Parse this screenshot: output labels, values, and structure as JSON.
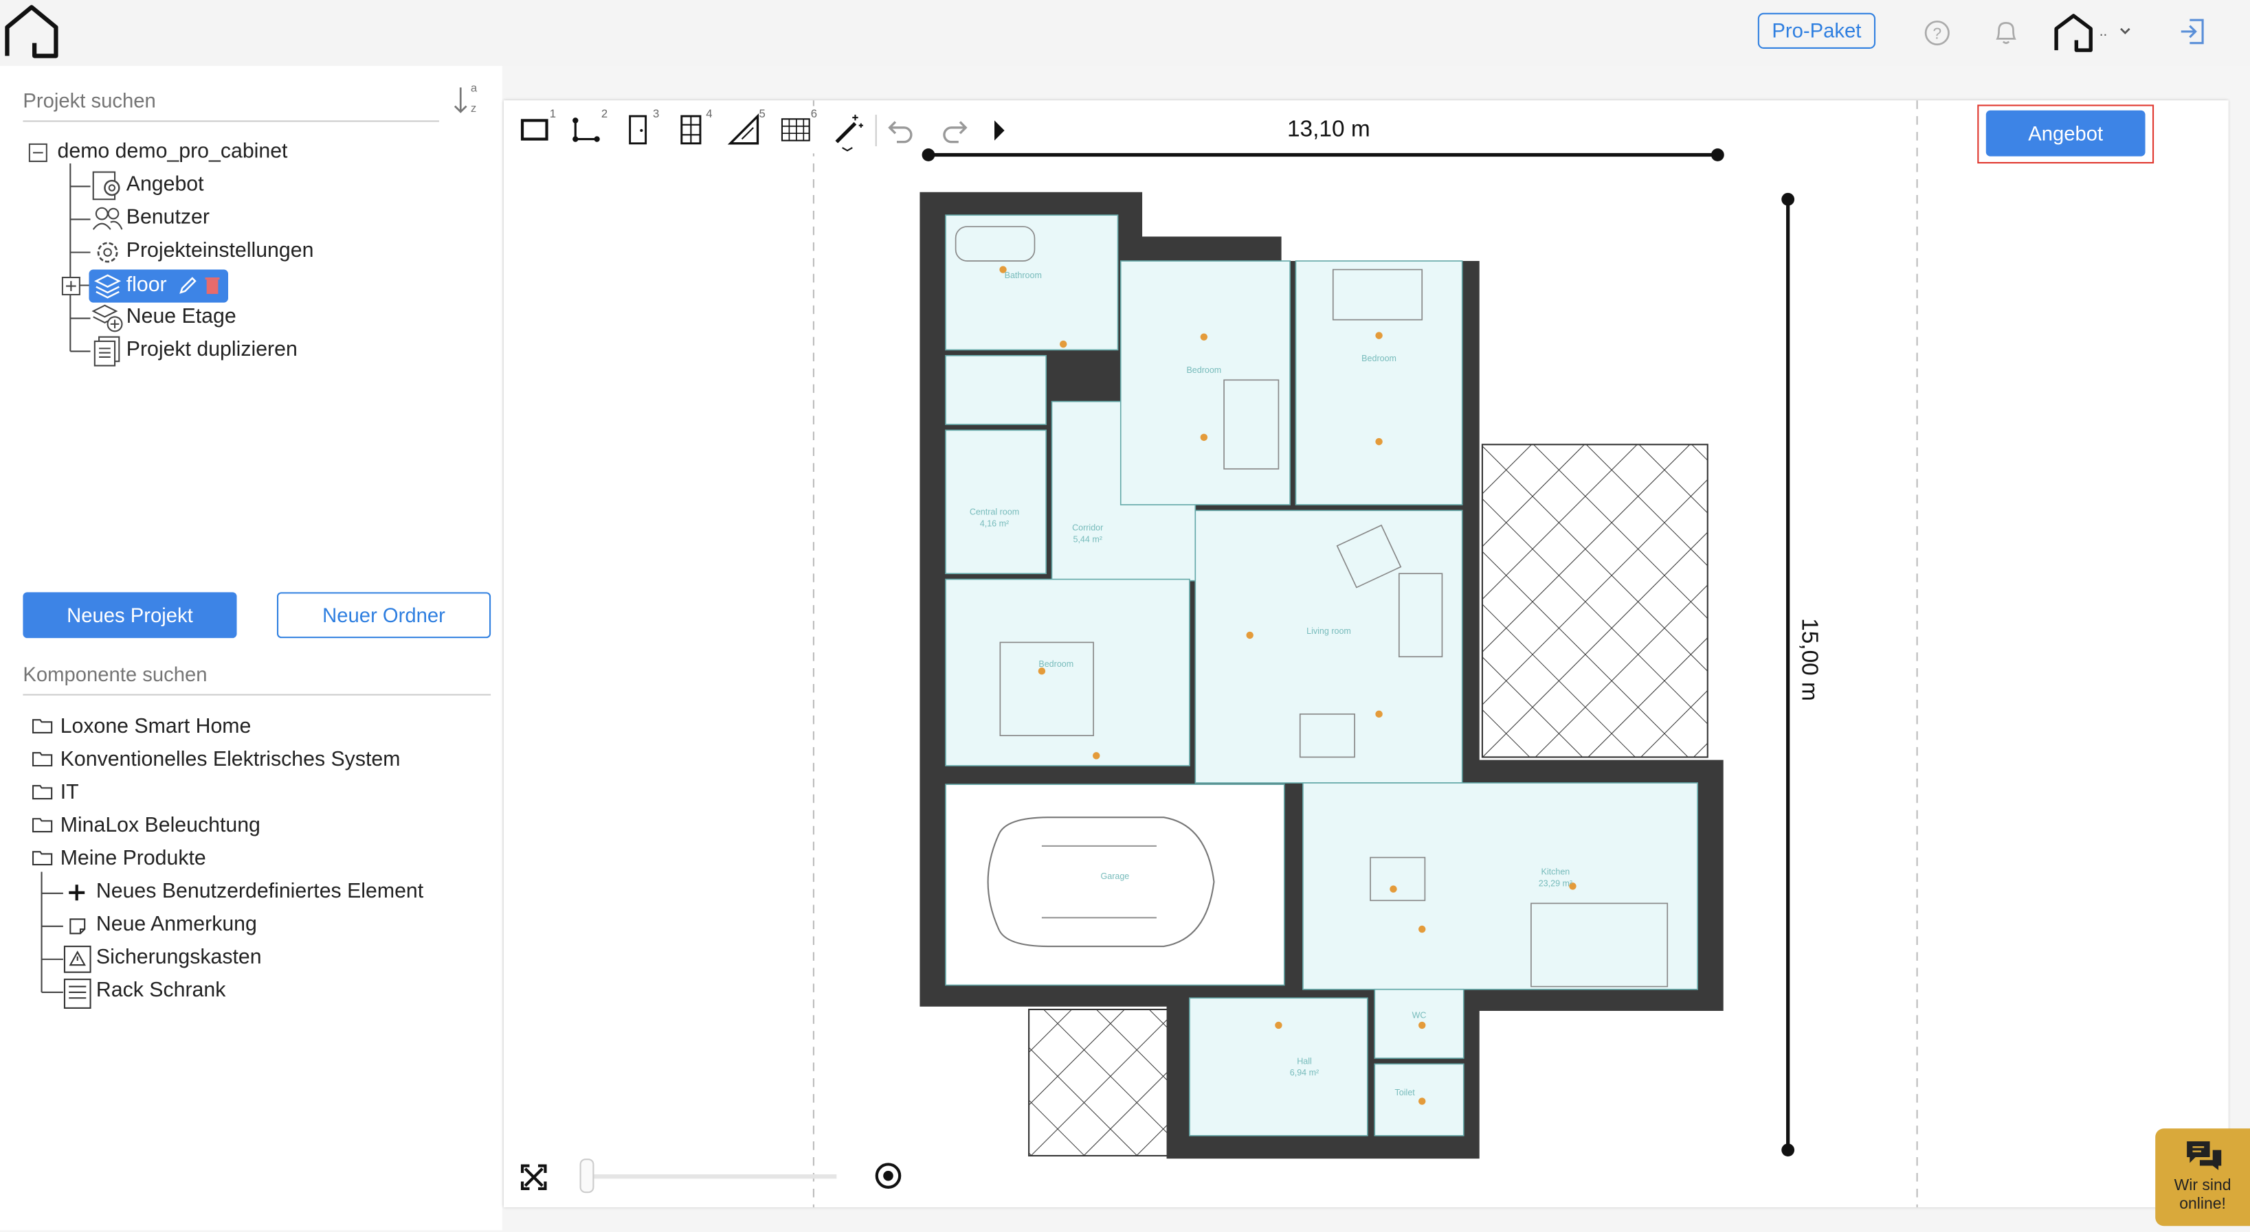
{
  "topbar": {
    "pro_label": "Pro-Paket",
    "icons": [
      "home-logo-icon",
      "help-icon",
      "bell-icon",
      "house-menu-icon",
      "logout-icon"
    ],
    "house_menu_suffix": ".."
  },
  "sidebar": {
    "project_search_placeholder": "Projekt suchen",
    "sort_label_top": "a",
    "sort_label_bottom": "z",
    "project_tree": {
      "root": "demo demo_pro_cabinet",
      "items": [
        "Angebot",
        "Benutzer",
        "Projekteinstellungen",
        "floor",
        "Neue Etage",
        "Projekt duplizieren"
      ]
    },
    "new_project_label": "Neues Projekt",
    "new_folder_label": "Neuer Ordner",
    "component_search_placeholder": "Komponente suchen",
    "component_folders": [
      "Loxone Smart Home",
      "Konventionelles Elektrisches System",
      "IT",
      "MinaLox Beleuchtung",
      "Meine Produkte"
    ],
    "my_products": [
      "Neues Benutzerdefiniertes Element",
      "Neue Anmerkung",
      "Sicherungskasten",
      "Rack Schrank"
    ]
  },
  "toolbar": {
    "tools": [
      {
        "name": "rectangle-room-tool",
        "num": "1"
      },
      {
        "name": "polygon-room-tool",
        "num": "2"
      },
      {
        "name": "door-tool",
        "num": "3"
      },
      {
        "name": "window-tool",
        "num": "4"
      },
      {
        "name": "measure-tool",
        "num": "5"
      },
      {
        "name": "stairs-tool",
        "num": "6"
      },
      {
        "name": "magic-wand-tool",
        "num": ""
      }
    ]
  },
  "canvas": {
    "angebot_label": "Angebot",
    "width_dimension": "13,10 m",
    "height_dimension": "15,00 m",
    "room_labels": [
      "Bathroom",
      "Bedroom",
      "Bedroom",
      "Central room",
      "Corridor",
      "Living room",
      "Bedroom",
      "Garage",
      "Kitchen",
      "Hall",
      "WC",
      "Toilet"
    ],
    "room_areas": [
      "4,16 m²",
      "5,44 m²",
      "23,29 m²",
      "6,94 m²"
    ]
  },
  "chat": {
    "line1": "Wir sind",
    "line2": "online!"
  },
  "colors": {
    "accent": "#3d84e6",
    "highlight_border": "#e0362d",
    "room_fill": "#e9f8f9",
    "wall": "#3a3a3a",
    "chat_bg": "#d9a93b"
  }
}
